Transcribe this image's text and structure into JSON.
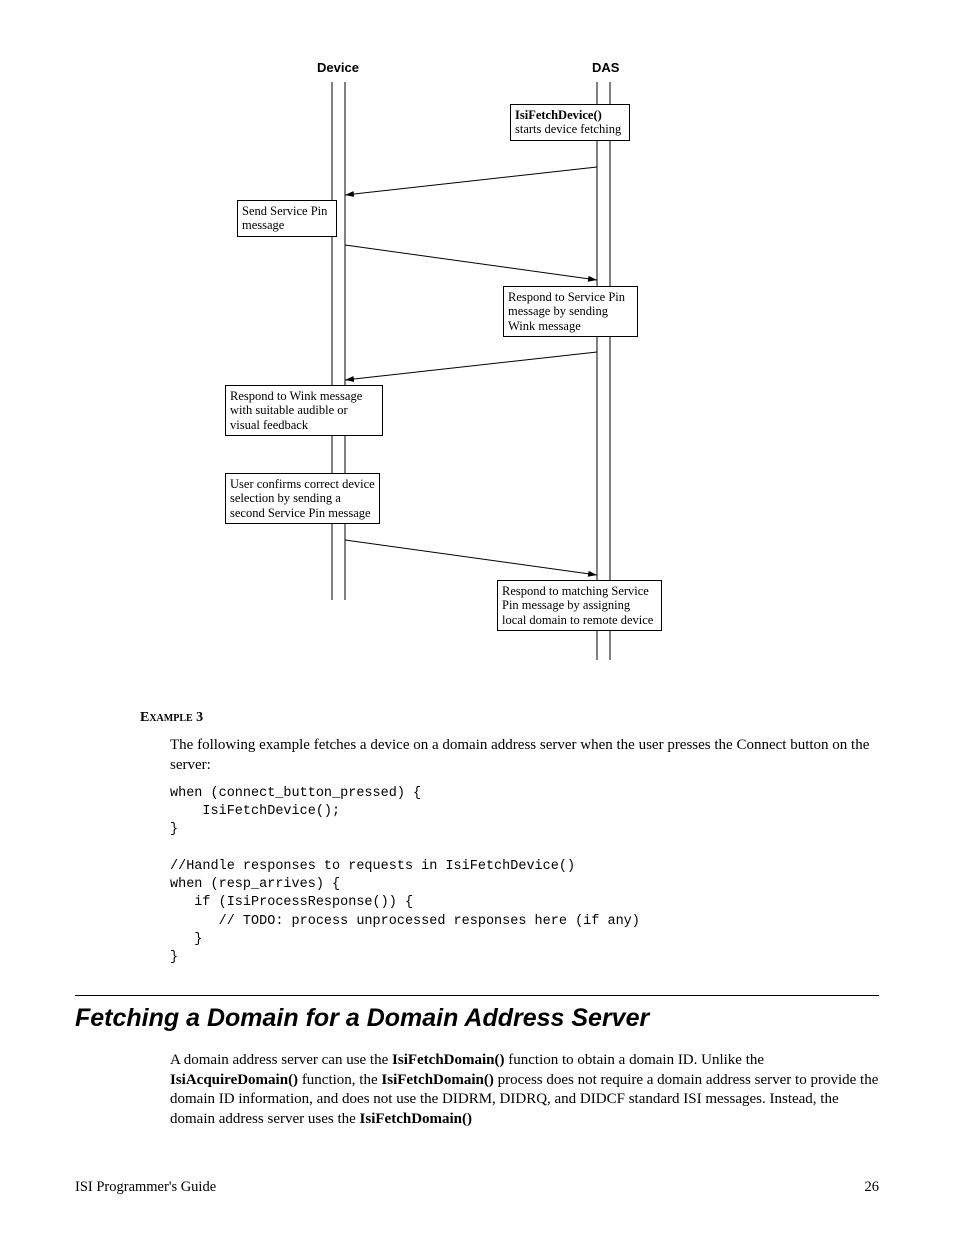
{
  "diagram": {
    "cols": {
      "device": "Device",
      "das": "DAS"
    },
    "box1": {
      "bold": "IsiFetchDevice()",
      "rest": " starts device fetching"
    },
    "box2": "Send Service Pin message",
    "box3": "Respond to Service Pin message by sending Wink message",
    "box4": "Respond to Wink message with suitable audible or visual feedback",
    "box5": "User confirms correct device selection by sending a second Service Pin message",
    "box6": "Respond to matching Service Pin message by assigning local domain to remote device"
  },
  "example_title": "Example 3",
  "example_text": "The following example fetches a device on a domain address server when the user presses the Connect button on the server:",
  "code": "when (connect_button_pressed) {\n    IsiFetchDevice();\n}\n\n//Handle responses to requests in IsiFetchDevice()\nwhen (resp_arrives) {\n   if (IsiProcessResponse()) {\n      // TODO: process unprocessed responses here (if any)\n   }\n}",
  "heading": "Fetching a Domain for a Domain Address Server",
  "para": {
    "p1a": "A domain address server can use the ",
    "p1b": "IsiFetchDomain()",
    "p1c": " function to obtain a domain ID.  Unlike the ",
    "p1d": "IsiAcquireDomain()",
    "p1e": " function, the ",
    "p1f": "IsiFetchDomain()",
    "p1g": " process does not require a domain address server to provide the domain ID information, and does not use the DIDRM, DIDRQ, and DIDCF standard ISI messages.  Instead, the domain address server uses the ",
    "p1h": "IsiFetchDomain()"
  },
  "footer": {
    "left": "ISI Programmer's Guide",
    "right": "26"
  }
}
